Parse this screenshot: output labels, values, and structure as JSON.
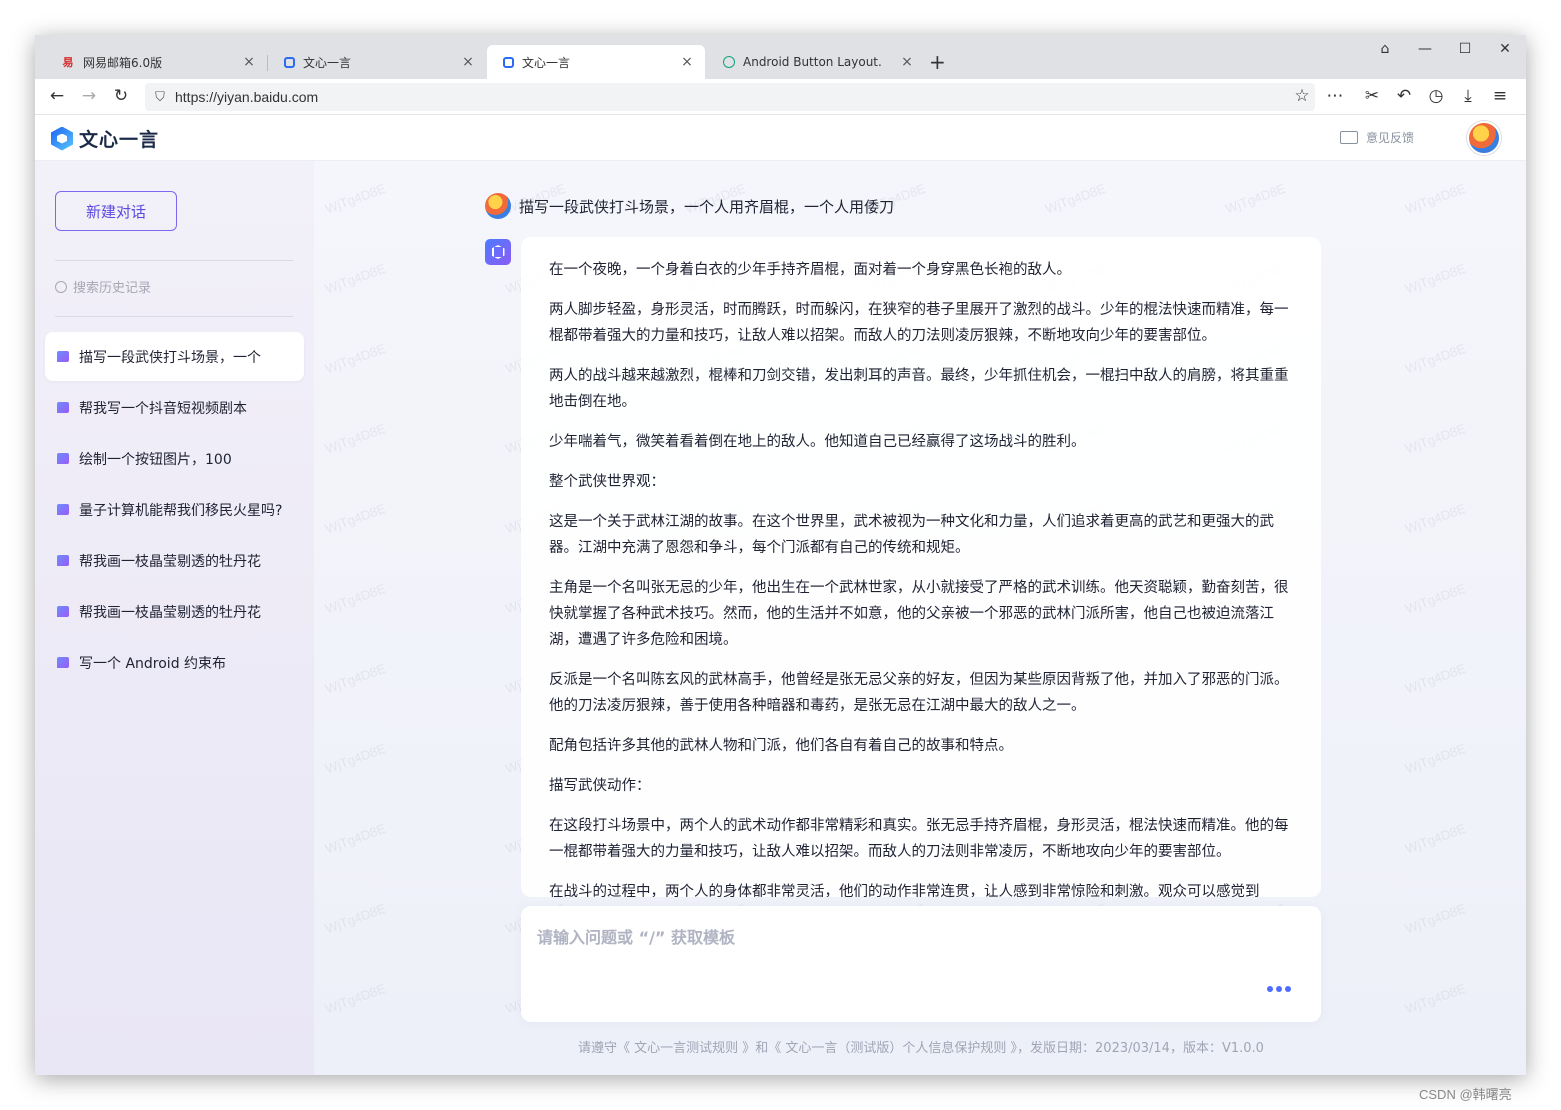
{
  "browser": {
    "tabs": [
      {
        "title": "网易邮箱6.0版",
        "icon": "netease-mail-icon",
        "active": false
      },
      {
        "title": "文心一言",
        "icon": "wenxin-icon",
        "active": false
      },
      {
        "title": "文心一言",
        "icon": "wenxin-icon",
        "active": true
      },
      {
        "title": "Android Button Layout.",
        "icon": "chatgpt-icon",
        "active": false
      }
    ],
    "url": "https://yiyan.baidu.com",
    "tab_close": "×",
    "new_tab": "+"
  },
  "app": {
    "name": "文心一言",
    "feedback_label": "意见反馈"
  },
  "sidebar": {
    "new_chat_label": "新建对话",
    "search_placeholder": "搜索历史记录",
    "history": [
      "描写一段武侠打斗场景，一个",
      "帮我写一个抖音短视频剧本",
      "绘制一个按钮图片，100",
      "量子计算机能帮我们移民火星吗?",
      "帮我画一枝晶莹剔透的牡丹花",
      "帮我画一枝晶莹剔透的牡丹花",
      "写一个 Android 约束布"
    ]
  },
  "conversation": {
    "user_question": "描写一段武侠打斗场景，一个人用齐眉棍，一个人用倭刀",
    "answer_paragraphs": [
      "在一个夜晚，一个身着白衣的少年手持齐眉棍，面对着一个身穿黑色长袍的敌人。",
      "两人脚步轻盈，身形灵活，时而腾跃，时而躲闪，在狭窄的巷子里展开了激烈的战斗。少年的棍法快速而精准，每一棍都带着强大的力量和技巧，让敌人难以招架。而敌人的刀法则凌厉狠辣，不断地攻向少年的要害部位。",
      "两人的战斗越来越激烈，棍棒和刀剑交错，发出刺耳的声音。最终，少年抓住机会，一棍扫中敌人的肩膀，将其重重地击倒在地。",
      "少年喘着气，微笑着看着倒在地上的敌人。他知道自己已经赢得了这场战斗的胜利。",
      "整个武侠世界观：",
      "这是一个关于武林江湖的故事。在这个世界里，武术被视为一种文化和力量，人们追求着更高的武艺和更强大的武器。江湖中充满了恩怨和争斗，每个门派都有自己的传统和规矩。",
      "主角是一个名叫张无忌的少年，他出生在一个武林世家，从小就接受了严格的武术训练。他天资聪颖，勤奋刻苦，很快就掌握了各种武术技巧。然而，他的生活并不如意，他的父亲被一个邪恶的武林门派所害，他自己也被迫流落江湖，遭遇了许多危险和困境。",
      "反派是一个名叫陈玄风的武林高手，他曾经是张无忌父亲的好友，但因为某些原因背叛了他，并加入了邪恶的门派。他的刀法凌厉狠辣，善于使用各种暗器和毒药，是张无忌在江湖中最大的敌人之一。",
      "配角包括许多其他的武林人物和门派，他们各自有着自己的故事和特点。",
      "描写武侠动作：",
      "在这段打斗场景中，两个人的武术动作都非常精彩和真实。张无忌手持齐眉棍，身形灵活，棍法快速而精准。他的每一棍都带着强大的力量和技巧，让敌人难以招架。而敌人的刀法则非常凌厉，不断地攻向少年的要害部位。",
      "在战斗的过程中，两个人的身体都非常灵活，他们的动作非常连贯，让人感到非常惊险和刺激。观众可以感觉到"
    ],
    "input_placeholder": "请输入问题或 “/” 获取模板"
  },
  "footer": "请遵守《 文心一言测试规则 》和《 文心一言（测试版）个人信息保护规则 》，发版日期：2023/03/14，版本：V1.0.0",
  "watermark_text": "WjTg4D8E",
  "csdn_credit": "CSDN @韩曙亮",
  "colors": {
    "accent": "#5b4ae0",
    "brand_blue": "#1c62f7"
  }
}
